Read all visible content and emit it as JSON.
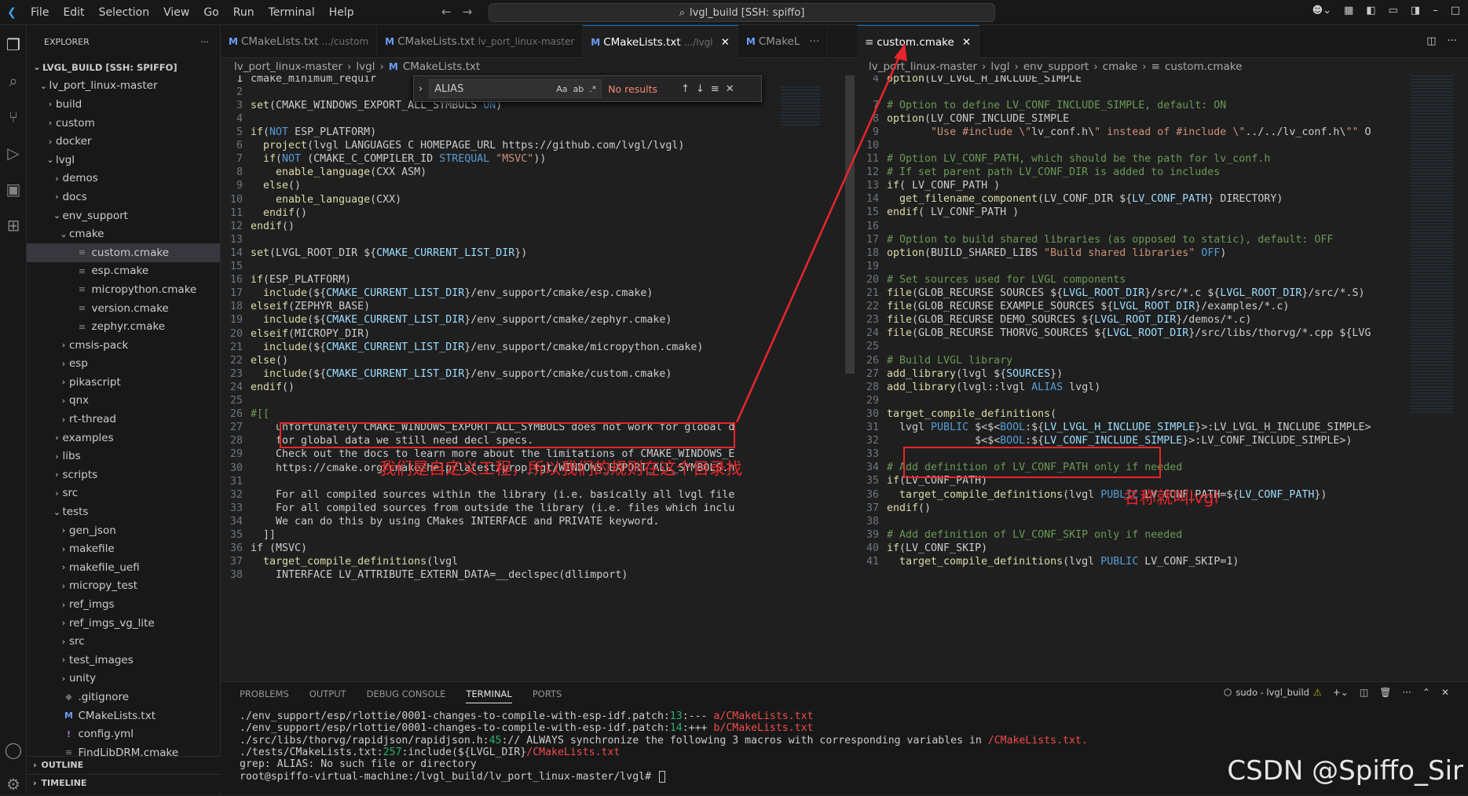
{
  "titlebar": {
    "menus": [
      "File",
      "Edit",
      "Selection",
      "View",
      "Go",
      "Run",
      "Terminal",
      "Help"
    ],
    "command_center": "lvgl_build [SSH: spiffo]"
  },
  "explorer": {
    "title": "EXPLORER",
    "root": "LVGL_BUILD [SSH: SPIFFO]",
    "items": [
      {
        "label": "lv_port_linux-master",
        "indent": 1,
        "type": "open"
      },
      {
        "label": "build",
        "indent": 2,
        "type": "closed"
      },
      {
        "label": "custom",
        "indent": 2,
        "type": "closed"
      },
      {
        "label": "docker",
        "indent": 2,
        "type": "closed"
      },
      {
        "label": "lvgl",
        "indent": 2,
        "type": "open"
      },
      {
        "label": "demos",
        "indent": 3,
        "type": "closed"
      },
      {
        "label": "docs",
        "indent": 3,
        "type": "closed"
      },
      {
        "label": "env_support",
        "indent": 3,
        "type": "open"
      },
      {
        "label": "cmake",
        "indent": 4,
        "type": "open"
      },
      {
        "label": "custom.cmake",
        "indent": 5,
        "type": "file",
        "selected": true
      },
      {
        "label": "esp.cmake",
        "indent": 5,
        "type": "file"
      },
      {
        "label": "micropython.cmake",
        "indent": 5,
        "type": "file"
      },
      {
        "label": "version.cmake",
        "indent": 5,
        "type": "file"
      },
      {
        "label": "zephyr.cmake",
        "indent": 5,
        "type": "file"
      },
      {
        "label": "cmsis-pack",
        "indent": 4,
        "type": "closed"
      },
      {
        "label": "esp",
        "indent": 4,
        "type": "closed"
      },
      {
        "label": "pikascript",
        "indent": 4,
        "type": "closed"
      },
      {
        "label": "qnx",
        "indent": 4,
        "type": "closed"
      },
      {
        "label": "rt-thread",
        "indent": 4,
        "type": "closed"
      },
      {
        "label": "examples",
        "indent": 3,
        "type": "closed"
      },
      {
        "label": "libs",
        "indent": 3,
        "type": "closed"
      },
      {
        "label": "scripts",
        "indent": 3,
        "type": "closed"
      },
      {
        "label": "src",
        "indent": 3,
        "type": "closed"
      },
      {
        "label": "tests",
        "indent": 3,
        "type": "open"
      },
      {
        "label": "gen_json",
        "indent": 4,
        "type": "closed"
      },
      {
        "label": "makefile",
        "indent": 4,
        "type": "closed"
      },
      {
        "label": "makefile_uefi",
        "indent": 4,
        "type": "closed"
      },
      {
        "label": "micropy_test",
        "indent": 4,
        "type": "closed"
      },
      {
        "label": "ref_imgs",
        "indent": 4,
        "type": "closed"
      },
      {
        "label": "ref_imgs_vg_lite",
        "indent": 4,
        "type": "closed"
      },
      {
        "label": "src",
        "indent": 4,
        "type": "closed"
      },
      {
        "label": "test_images",
        "indent": 4,
        "type": "closed"
      },
      {
        "label": "unity",
        "indent": 4,
        "type": "closed"
      },
      {
        "label": ".gitignore",
        "indent": 3,
        "type": "git"
      },
      {
        "label": "CMakeLists.txt",
        "indent": 3,
        "type": "m"
      },
      {
        "label": "config.yml",
        "indent": 3,
        "type": "yml"
      },
      {
        "label": "FindLibDRM.cmake",
        "indent": 3,
        "type": "file"
      }
    ],
    "outline": "OUTLINE",
    "timeline": "TIMELINE"
  },
  "left_editor": {
    "tabs": [
      {
        "name": "CMakeLists.txt",
        "desc": ".../custom"
      },
      {
        "name": "CMakeLists.txt",
        "desc": "lv_port_linux-master"
      },
      {
        "name": "CMakeLists.txt",
        "desc": ".../lvgl",
        "active": true
      },
      {
        "name": "CMakeL",
        "desc": ""
      }
    ],
    "breadcrumb": [
      "lv_port_linux-master",
      "lvgl",
      "CMakeLists.txt"
    ],
    "find": {
      "query": "ALIAS",
      "result": "No results"
    },
    "lines": [
      [
        "1",
        "cmake_minimum_requir"
      ],
      [
        "2",
        ""
      ],
      [
        "3",
        "set(CMAKE_WINDOWS_EXPORT_ALL_SYMBOLS ON)"
      ],
      [
        "4",
        ""
      ],
      [
        "5",
        "if(NOT ESP_PLATFORM)"
      ],
      [
        "6",
        "  project(lvgl LANGUAGES C HOMEPAGE_URL https://github.com/lvgl/lvgl)"
      ],
      [
        "7",
        "  if(NOT (CMAKE_C_COMPILER_ID STREQUAL \"MSVC\"))"
      ],
      [
        "8",
        "    enable_language(CXX ASM)"
      ],
      [
        "9",
        "  else()"
      ],
      [
        "10",
        "    enable_language(CXX)"
      ],
      [
        "11",
        "  endif()"
      ],
      [
        "12",
        "endif()"
      ],
      [
        "13",
        ""
      ],
      [
        "14",
        "set(LVGL_ROOT_DIR ${CMAKE_CURRENT_LIST_DIR})"
      ],
      [
        "15",
        ""
      ],
      [
        "16",
        "if(ESP_PLATFORM)"
      ],
      [
        "17",
        "  include(${CMAKE_CURRENT_LIST_DIR}/env_support/cmake/esp.cmake)"
      ],
      [
        "18",
        "elseif(ZEPHYR_BASE)"
      ],
      [
        "19",
        "  include(${CMAKE_CURRENT_LIST_DIR}/env_support/cmake/zephyr.cmake)"
      ],
      [
        "20",
        "elseif(MICROPY_DIR)"
      ],
      [
        "21",
        "  include(${CMAKE_CURRENT_LIST_DIR}/env_support/cmake/micropython.cmake)"
      ],
      [
        "22",
        "else()"
      ],
      [
        "23",
        "  include(${CMAKE_CURRENT_LIST_DIR}/env_support/cmake/custom.cmake)"
      ],
      [
        "24",
        "endif()"
      ],
      [
        "25",
        ""
      ],
      [
        "26",
        "#[["
      ],
      [
        "27",
        "    unfortunately CMAKE_WINDOWS_EXPORT_ALL_SYMBOLS does not work for global d"
      ],
      [
        "28",
        "    for global data we still need decl specs."
      ],
      [
        "29",
        "    Check out the docs to learn more about the limitations of CMAKE_WINDOWS_E"
      ],
      [
        "30",
        "    https://cmake.org/cmake/help/latest/prop_tgt/WINDOWS_EXPORT_ALL_SYMBOLS.h"
      ],
      [
        "31",
        ""
      ],
      [
        "32",
        "    For all compiled sources within the library (i.e. basically all lvgl file"
      ],
      [
        "33",
        "    For all compiled sources from outside the library (i.e. files which inclu"
      ],
      [
        "34",
        "    We can do this by using CMakes INTERFACE and PRIVATE keyword."
      ],
      [
        "35",
        "  ]]"
      ],
      [
        "36",
        "if (MSVC)"
      ],
      [
        "37",
        "  target_compile_definitions(lvgl"
      ],
      [
        "38",
        "    INTERFACE LV_ATTRIBUTE_EXTERN_DATA=__declspec(dllimport)"
      ]
    ],
    "annotation": "我们是自定义工程，所以我们的规则在这个目录找"
  },
  "right_editor": {
    "tab": "custom.cmake",
    "breadcrumb": [
      "lv_port_linux-master",
      "lvgl",
      "env_support",
      "cmake",
      "custom.cmake"
    ],
    "lines": [
      [
        "4",
        "option(LV_LVGL_H_INCLUDE_SIMPLE"
      ],
      [
        "7",
        "# Option to define LV_CONF_INCLUDE_SIMPLE, default: ON"
      ],
      [
        "8",
        "option(LV_CONF_INCLUDE_SIMPLE"
      ],
      [
        "9",
        "       \"Use #include \\\"lv_conf.h\\\" instead of #include \\\"../../lv_conf.h\\\"\" O"
      ],
      [
        "10",
        ""
      ],
      [
        "11",
        "# Option LV_CONF_PATH, which should be the path for lv_conf.h"
      ],
      [
        "12",
        "# If set parent path LV_CONF_DIR is added to includes"
      ],
      [
        "13",
        "if( LV_CONF_PATH )"
      ],
      [
        "14",
        "  get_filename_component(LV_CONF_DIR ${LV_CONF_PATH} DIRECTORY)"
      ],
      [
        "15",
        "endif( LV_CONF_PATH )"
      ],
      [
        "16",
        ""
      ],
      [
        "17",
        "# Option to build shared libraries (as opposed to static), default: OFF"
      ],
      [
        "18",
        "option(BUILD_SHARED_LIBS \"Build shared libraries\" OFF)"
      ],
      [
        "19",
        ""
      ],
      [
        "20",
        "# Set sources used for LVGL components"
      ],
      [
        "21",
        "file(GLOB_RECURSE SOURCES ${LVGL_ROOT_DIR}/src/*.c ${LVGL_ROOT_DIR}/src/*.S)"
      ],
      [
        "22",
        "file(GLOB_RECURSE EXAMPLE_SOURCES ${LVGL_ROOT_DIR}/examples/*.c)"
      ],
      [
        "23",
        "file(GLOB_RECURSE DEMO_SOURCES ${LVGL_ROOT_DIR}/demos/*.c)"
      ],
      [
        "24",
        "file(GLOB_RECURSE THORVG_SOURCES ${LVGL_ROOT_DIR}/src/libs/thorvg/*.cpp ${LVG"
      ],
      [
        "25",
        ""
      ],
      [
        "26",
        "# Build LVGL library"
      ],
      [
        "27",
        "add_library(lvgl ${SOURCES})"
      ],
      [
        "28",
        "add_library(lvgl::lvgl ALIAS lvgl)"
      ],
      [
        "29",
        ""
      ],
      [
        "30",
        "target_compile_definitions("
      ],
      [
        "31",
        "  lvgl PUBLIC $<$<BOOL:${LV_LVGL_H_INCLUDE_SIMPLE}>:LV_LVGL_H_INCLUDE_SIMPLE>"
      ],
      [
        "32",
        "              $<$<BOOL:${LV_CONF_INCLUDE_SIMPLE}>:LV_CONF_INCLUDE_SIMPLE>)"
      ],
      [
        "33",
        ""
      ],
      [
        "34",
        "# Add definition of LV_CONF_PATH only if needed"
      ],
      [
        "35",
        "if(LV_CONF_PATH)"
      ],
      [
        "36",
        "  target_compile_definitions(lvgl PUBLIC LV_CONF_PATH=${LV_CONF_PATH})"
      ],
      [
        "37",
        "endif()"
      ],
      [
        "38",
        ""
      ],
      [
        "39",
        "# Add definition of LV_CONF_SKIP only if needed"
      ],
      [
        "40",
        "if(LV_CONF_SKIP)"
      ],
      [
        "41",
        "  target_compile_definitions(lvgl PUBLIC LV_CONF_SKIP=1)"
      ]
    ],
    "annotation": "名称就叫lvgl"
  },
  "panel": {
    "tabs": [
      "PROBLEMS",
      "OUTPUT",
      "DEBUG CONSOLE",
      "TERMINAL",
      "PORTS"
    ],
    "active_tab": "TERMINAL",
    "terminal_name": "sudo - lvgl_build",
    "terminal": [
      {
        "a": "./env_support/esp/rlottie/0001-changes-to-compile-with-esp-idf.patch:",
        "g": "13",
        "b": ":--- ",
        "r": "a/CMakeLists.txt"
      },
      {
        "a": "./env_support/esp/rlottie/0001-changes-to-compile-with-esp-idf.patch:",
        "g": "14",
        "b": ":+++ ",
        "r": "b/CMakeLists.txt"
      },
      {
        "a": "./src/libs/thorvg/rapidjson/rapidjson.h:",
        "g": "45",
        "b": ":// ALWAYS synchronize the following 3 macros with corresponding variables in ",
        "r": "/CMakeLists.txt."
      },
      {
        "a": "./tests/CMakeLists.txt:",
        "g": "257",
        "b": ":include(${LVGL_DIR}",
        "r": "/CMakeLists.txt"
      },
      {
        "a": "grep: ALIAS: No such file or directory",
        "g": "",
        "b": "",
        "r": ""
      },
      {
        "a": "root@spiffo-virtual-machine:/lvgl_build/lv_port_linux-master/lvgl# ",
        "g": "",
        "b": "",
        "r": ""
      }
    ]
  },
  "watermark": "CSDN @Spiffo_Sir",
  "colors": {
    "accent": "#0078d4",
    "annotation": "#e8262a"
  }
}
